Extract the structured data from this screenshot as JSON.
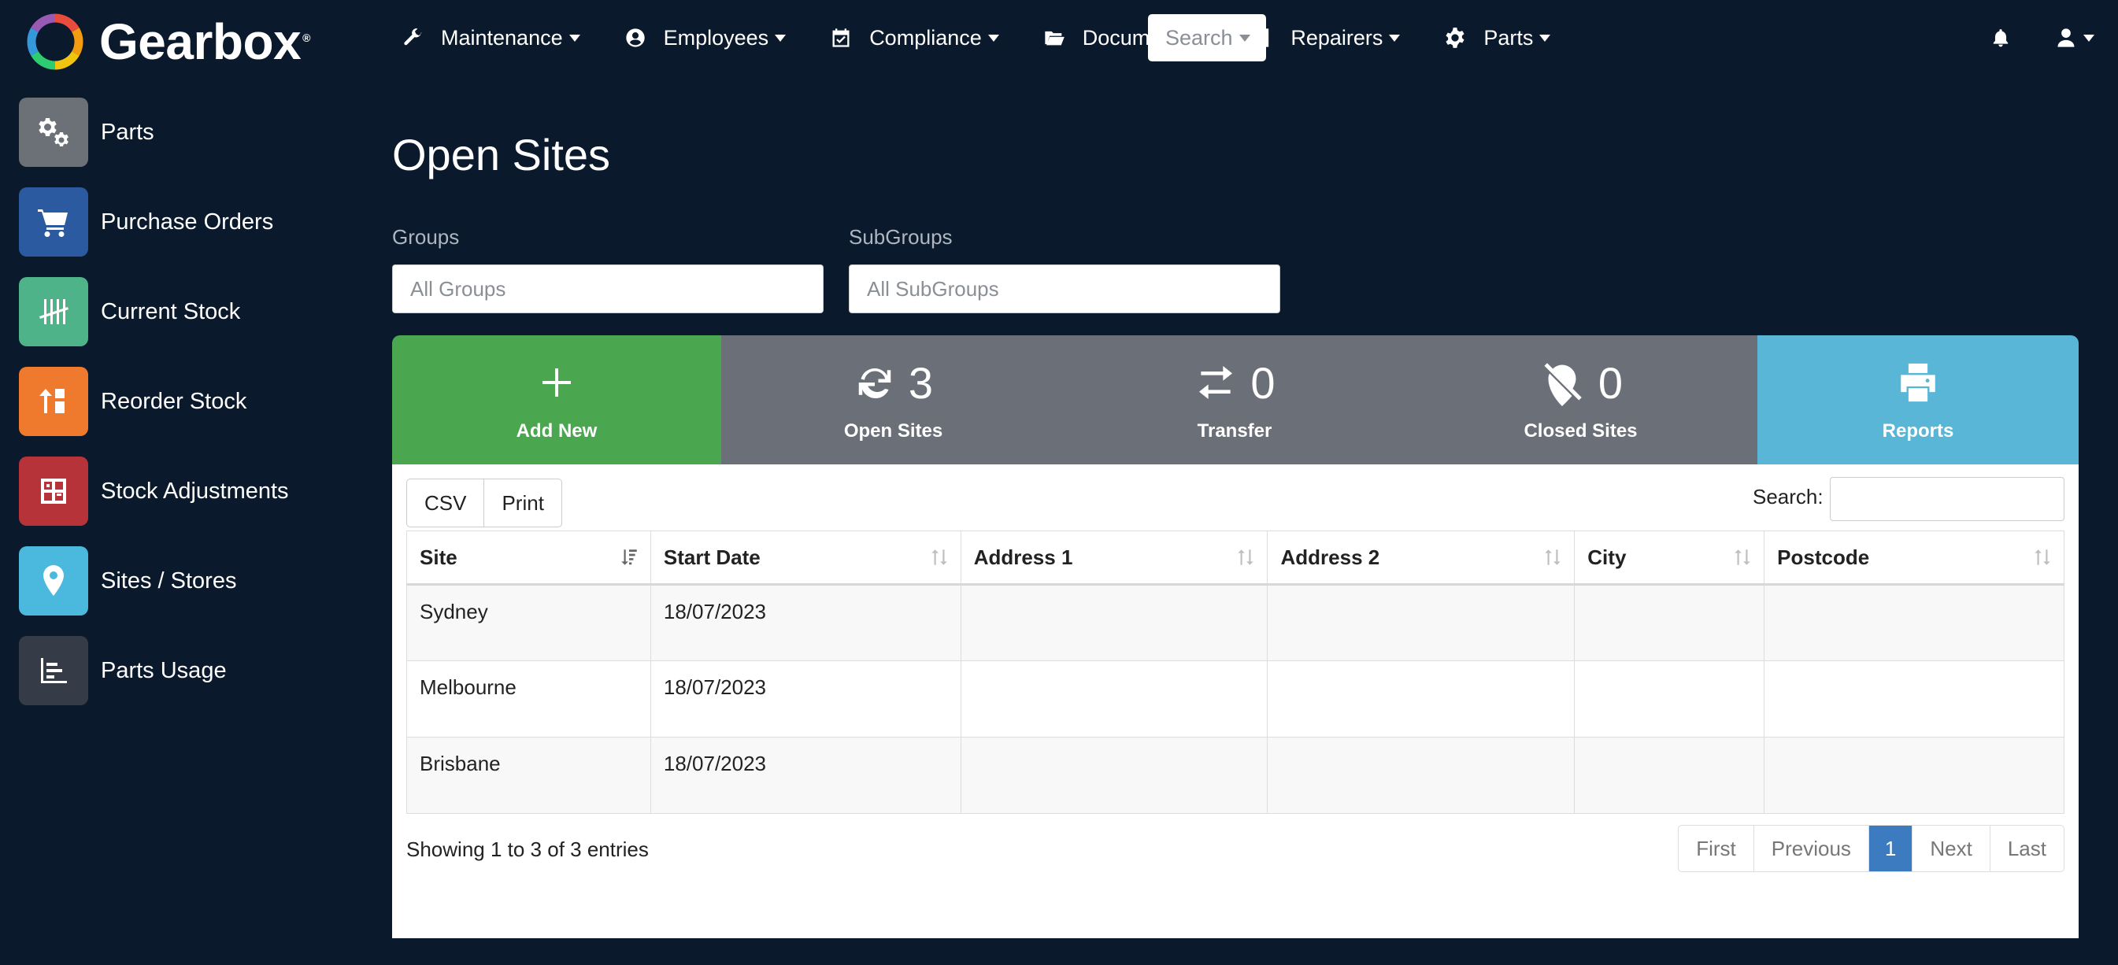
{
  "app": {
    "name": "Gearbox"
  },
  "nav": {
    "items": [
      {
        "label": "Maintenance",
        "icon": "wrench-icon"
      },
      {
        "label": "Employees",
        "icon": "user-circle-icon"
      },
      {
        "label": "Compliance",
        "icon": "calendar-check-icon"
      },
      {
        "label": "Documents",
        "icon": "folder-open-icon"
      },
      {
        "label": "Repairers",
        "icon": "contact-card-icon"
      },
      {
        "label": "Parts",
        "icon": "gear-icon"
      }
    ],
    "search_label": "Search"
  },
  "sidebar": {
    "items": [
      {
        "label": "Parts",
        "icon": "gears-icon",
        "color": "#6c7077"
      },
      {
        "label": "Purchase Orders",
        "icon": "cart-icon",
        "color": "#2c5aa0"
      },
      {
        "label": "Current Stock",
        "icon": "tally-icon",
        "color": "#4fb38a"
      },
      {
        "label": "Reorder Stock",
        "icon": "reorder-icon",
        "color": "#ef7a2d"
      },
      {
        "label": "Stock Adjustments",
        "icon": "adjust-icon",
        "color": "#b7333a"
      },
      {
        "label": "Sites / Stores",
        "icon": "map-pin-icon",
        "color": "#4bb8de"
      },
      {
        "label": "Parts Usage",
        "icon": "bar-chart-icon",
        "color": "#363c47"
      }
    ]
  },
  "page": {
    "title": "Open Sites"
  },
  "filters": {
    "groups_label": "Groups",
    "groups_placeholder": "All Groups",
    "subgroups_label": "SubGroups",
    "subgroups_placeholder": "All SubGroups"
  },
  "stats": {
    "add_label": "Add New",
    "open_count": "3",
    "open_label": "Open Sites",
    "transfer_count": "0",
    "transfer_label": "Transfer",
    "closed_count": "0",
    "closed_label": "Closed Sites",
    "reports_label": "Reports"
  },
  "table": {
    "csv_label": "CSV",
    "print_label": "Print",
    "search_label": "Search:",
    "columns": [
      "Site",
      "Start Date",
      "Address 1",
      "Address 2",
      "City",
      "Postcode"
    ],
    "rows": [
      [
        "Sydney",
        "18/07/2023",
        "",
        "",
        "",
        ""
      ],
      [
        "Melbourne",
        "18/07/2023",
        "",
        "",
        "",
        ""
      ],
      [
        "Brisbane",
        "18/07/2023",
        "",
        "",
        "",
        ""
      ]
    ],
    "info": "Showing 1 to 3 of 3 entries",
    "pager": {
      "first": "First",
      "previous": "Previous",
      "current": "1",
      "next": "Next",
      "last": "Last"
    }
  }
}
